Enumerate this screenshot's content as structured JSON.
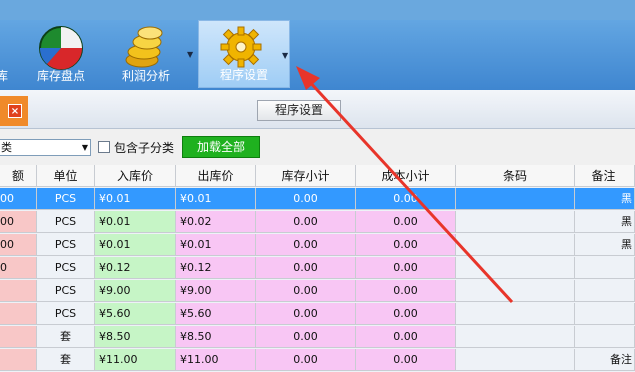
{
  "ribbon": {
    "items": [
      {
        "label": "库存盘点",
        "icon": "pie-chart-icon"
      },
      {
        "label": "利润分析",
        "icon": "gold-coins-icon"
      },
      {
        "label": "程序设置",
        "icon": "gear-icon"
      }
    ],
    "left_partial_label": "库"
  },
  "toolbar": {
    "close_label": "×",
    "settings_button": "程序设置"
  },
  "filter": {
    "combo_value": "类",
    "checkbox_label": "包含子分类",
    "load_all": "加载全部"
  },
  "table": {
    "headers": [
      "额",
      "单位",
      "入库价",
      "出库价",
      "库存小计",
      "成本小计",
      "条码",
      "备注"
    ],
    "rows": [
      [
        "00",
        "PCS",
        "¥0.01",
        "¥0.01",
        "0.00",
        "0.00",
        "",
        "黑"
      ],
      [
        "00",
        "PCS",
        "¥0.01",
        "¥0.02",
        "0.00",
        "0.00",
        "",
        "黑"
      ],
      [
        "00",
        "PCS",
        "¥0.01",
        "¥0.01",
        "0.00",
        "0.00",
        "",
        "黑"
      ],
      [
        "0",
        "PCS",
        "¥0.12",
        "¥0.12",
        "0.00",
        "0.00",
        "",
        ""
      ],
      [
        "",
        "PCS",
        "¥9.00",
        "¥9.00",
        "0.00",
        "0.00",
        "",
        ""
      ],
      [
        "",
        "PCS",
        "¥5.60",
        "¥5.60",
        "0.00",
        "0.00",
        "",
        ""
      ],
      [
        "",
        "套",
        "¥8.50",
        "¥8.50",
        "0.00",
        "0.00",
        "",
        ""
      ],
      [
        "",
        "套",
        "¥11.00",
        "¥11.00",
        "0.00",
        "0.00",
        "",
        "备注"
      ]
    ],
    "selected_row": 0
  },
  "colors": {
    "ribbon": "#3f86d0",
    "selected_row": "#3399ff",
    "in_price_bg": "#c6f5c6",
    "out_price_bg": "#f8c6f4",
    "first_col_bg": "#f8c7c7",
    "load_button": "#1fb11f",
    "arrow": "#e8352a"
  }
}
